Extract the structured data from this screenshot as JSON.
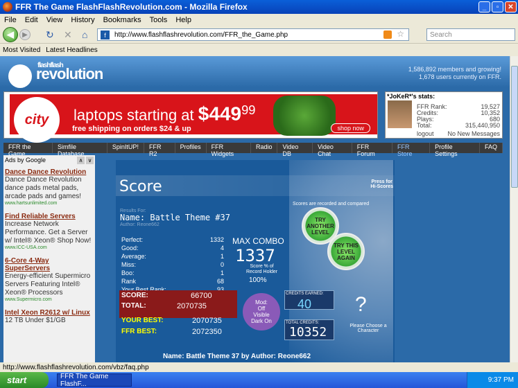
{
  "window": {
    "title": "FFR The Game FlashFlashRevolution.com - Mozilla Firefox"
  },
  "menu": [
    "File",
    "Edit",
    "View",
    "History",
    "Bookmarks",
    "Tools",
    "Help"
  ],
  "url": "http://www.flashflashrevolution.com/FFR_the_Game.php",
  "search_placeholder": "Search",
  "bookmarks": [
    "Most Visited",
    "Latest Headlines"
  ],
  "site": {
    "logo_top": "flashflash",
    "logo_main": "revolution",
    "members_line1": "1,586,892 members and growing!",
    "members_line2": "1,678 users currently on FFR."
  },
  "ad": {
    "brand": "city",
    "line1": "laptops starting at",
    "price": "$449",
    "cents": "99",
    "line2": "free shipping on orders $24 & up",
    "cta": "shop now"
  },
  "user": {
    "title": "*JoKeR*'s stats:",
    "rank_label": "FFR Rank:",
    "rank": "19,527",
    "credits_label": "Credits:",
    "credits": "10,352",
    "plays_label": "Plays:",
    "plays": "680",
    "total_label": "Total:",
    "total": "315,440,950",
    "logout": "logout",
    "messages": "No New Messages"
  },
  "nav_tabs": [
    "FFR the Game",
    "Simfile Database",
    "SpinItUP!",
    "FFR R2",
    "Profiles",
    "FFR Widgets",
    "Radio",
    "Video DB",
    "Video Chat",
    "FFR Forum",
    "FFR Store",
    "Profile Settings",
    "FAQ"
  ],
  "sidebar": {
    "ads_by": "Ads by Google",
    "ads": [
      {
        "title": "Dance Dance Revolution",
        "desc": "Dance Dance Revolution dance pads metal pads, arcade pads and games!",
        "url": "www.hartsunlimited.com"
      },
      {
        "title": "Find Reliable Servers",
        "desc": "Increase Network Performance. Get a Server w/ Intel® Xeon® Shop Now!",
        "url": "www.ICC-USA.com"
      },
      {
        "title": "6-Core 4-Way SuperServers",
        "desc": "Energy-efficient Supermicro Servers Featuring Intel® Xeon® Processors",
        "url": "www.Supermicro.com"
      },
      {
        "title": "Intel Xeon R2612 w/ Linux",
        "desc": "12 TB Under $1/GB",
        "url": ""
      }
    ]
  },
  "game": {
    "heading": "Score",
    "press": "Press for\nHi-Scores",
    "recorded": "Scores are recorded and compared",
    "results_for": "Results For:",
    "name": "Name: Battle Theme #37",
    "author": "Author: Reone662",
    "stats": [
      {
        "label": "Perfect:",
        "value": "1332"
      },
      {
        "label": "Good:",
        "value": "4"
      },
      {
        "label": "Average:",
        "value": "1"
      },
      {
        "label": "Miss:",
        "value": "0"
      },
      {
        "label": "Boo:",
        "value": "1"
      },
      {
        "label": "Rank",
        "value": "68"
      },
      {
        "label": "Your Best Rank:",
        "value": "93"
      }
    ],
    "max_combo_label": "MAX COMBO",
    "max_combo": "1337",
    "score_pct_label": "Score % of\nRecord Holder",
    "score_pct": "100%",
    "try_another": "TRY ANOTHER LEVEL",
    "try_again": "TRY THIS LEVEL AGAIN",
    "score_label": "SCORE:",
    "score": "66700",
    "total_label": "TOTAL:",
    "total": "2070735",
    "your_best_label": "YOUR BEST:",
    "your_best": "2070735",
    "ffr_best_label": "FFR BEST:",
    "ffr_best": "2072350",
    "visible": [
      "Mod:",
      "Off",
      "Visible",
      "Dark On"
    ],
    "credits_earned_label": "CREDITS EARNED:",
    "credits_earned": "40",
    "total_credits_label": "TOTAL CREDITS:",
    "total_credits": "10352",
    "question": "?",
    "choose": "Please Choose a Character",
    "footer": "Name: Battle Theme  37 by Author: Reone662"
  },
  "status": "http://www.flashflashrevolution.com/vbz/faq.php",
  "taskbar": {
    "start": "start",
    "task": "FFR The Game FlashF...",
    "clock": "9:37 PM"
  }
}
